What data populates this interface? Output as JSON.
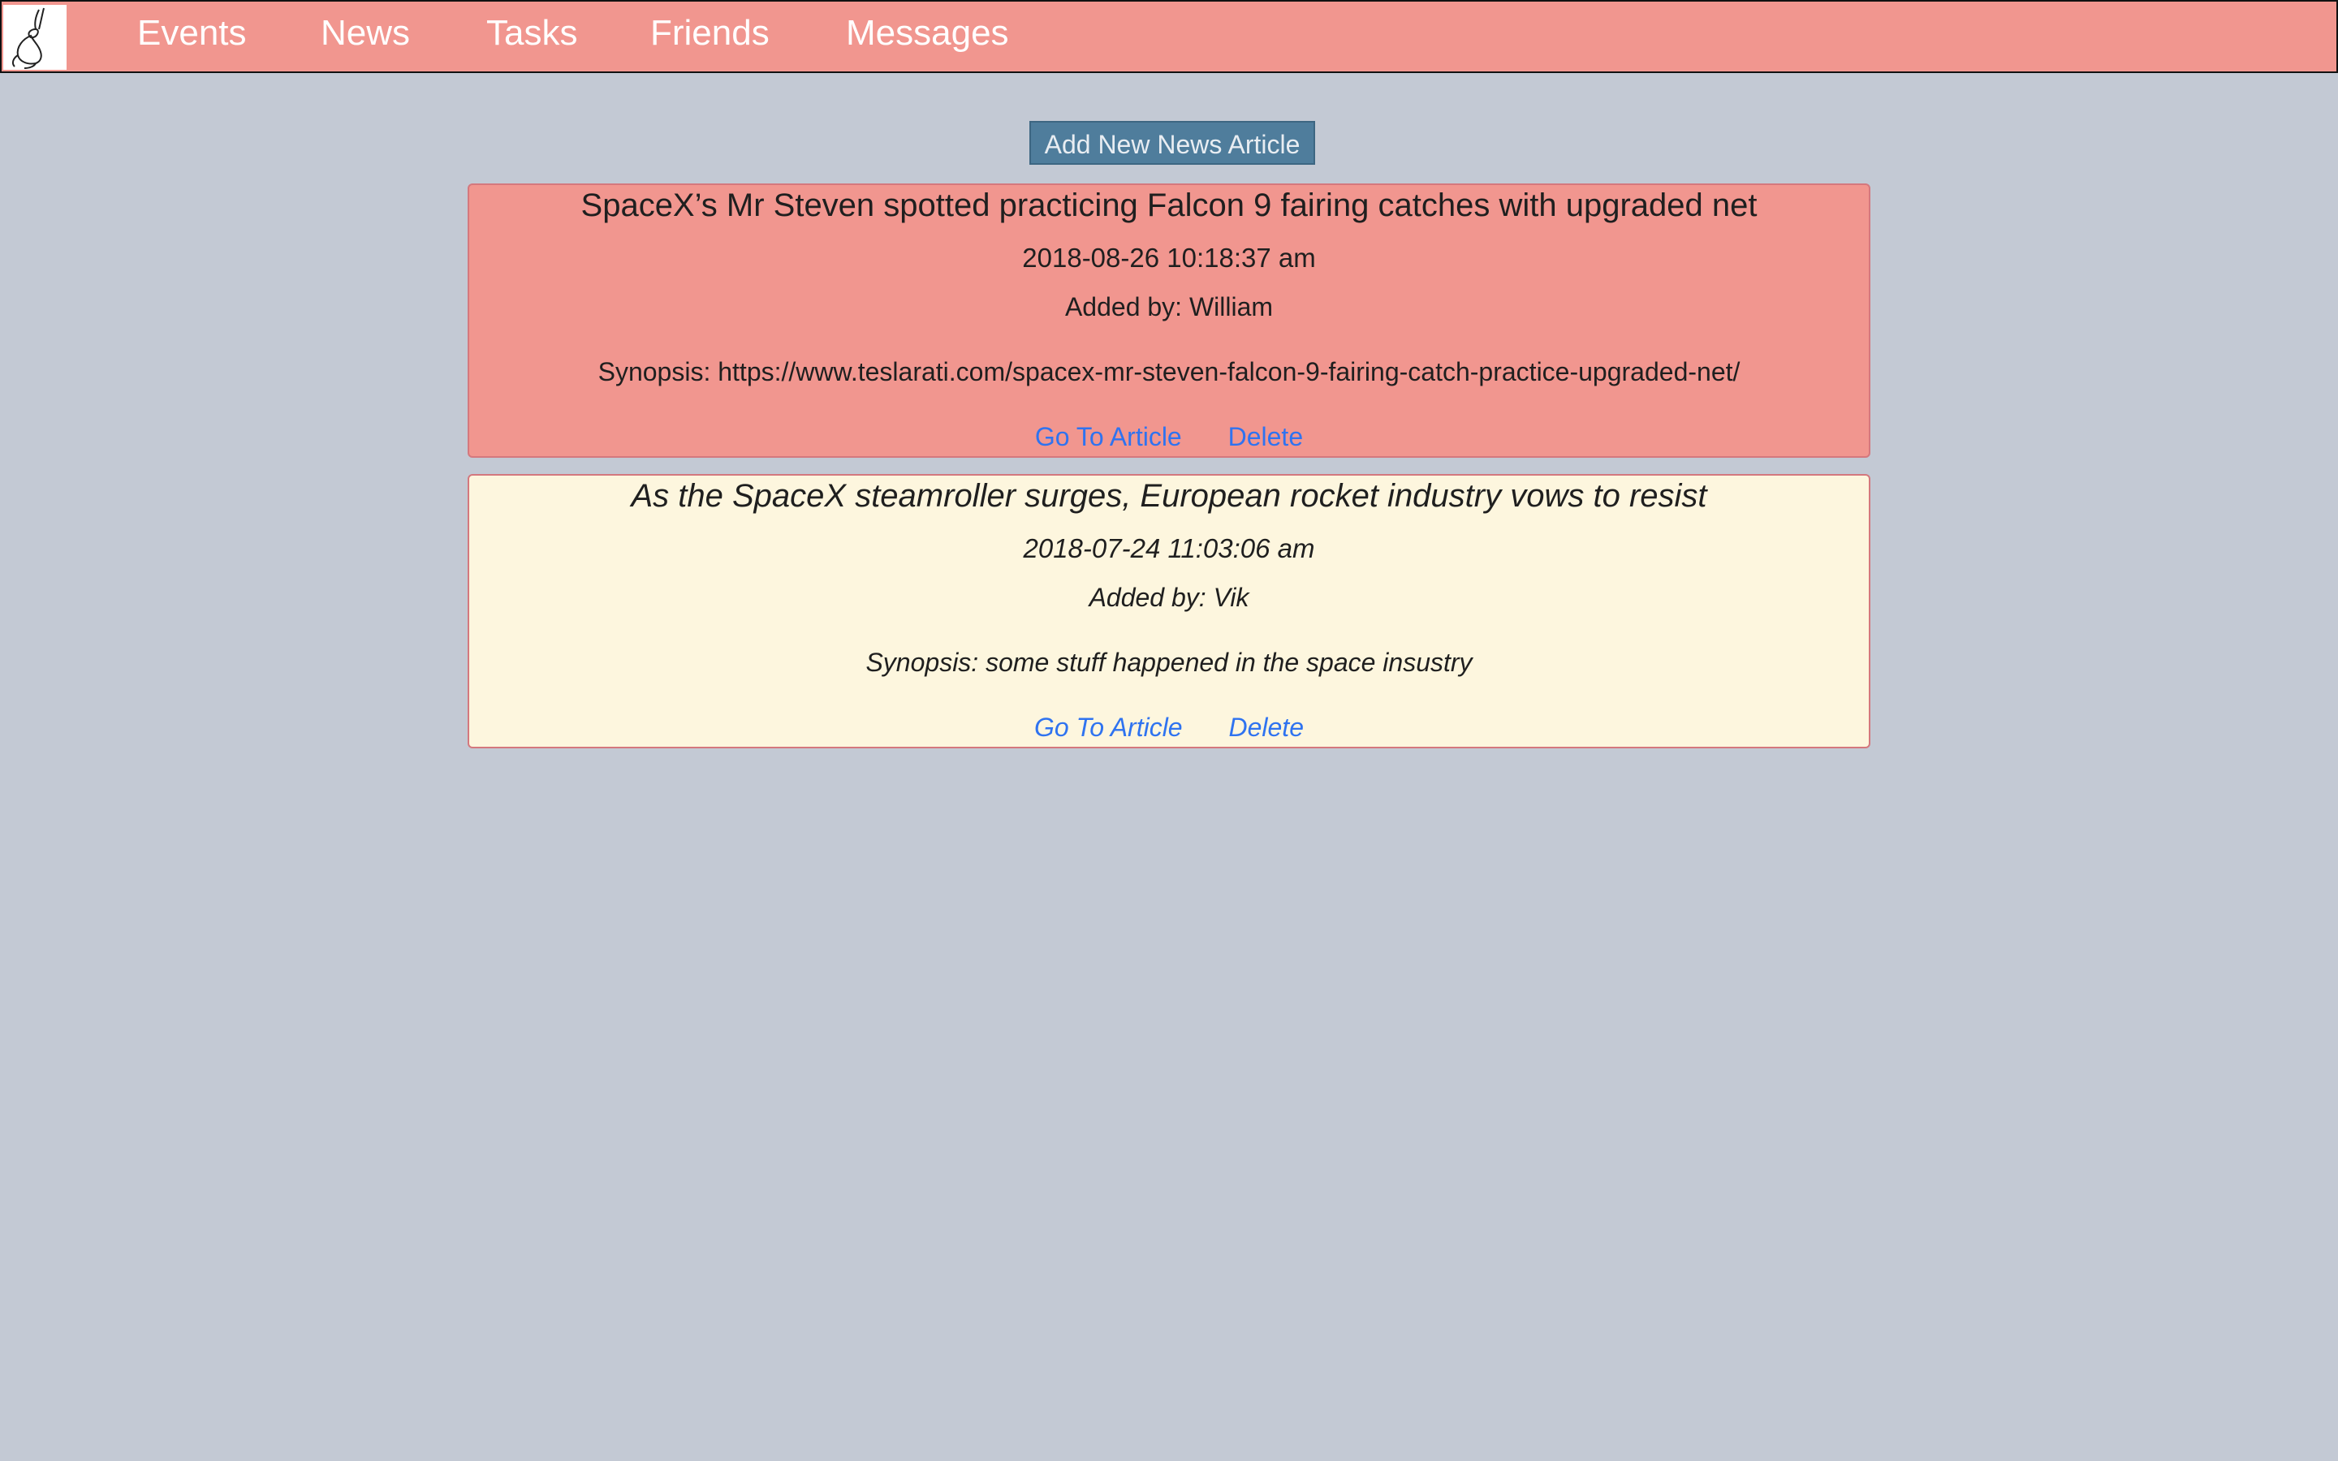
{
  "navbar": {
    "logo_icon": "rabbit-logo-icon",
    "items": [
      {
        "label": "Events"
      },
      {
        "label": "News"
      },
      {
        "label": "Tasks"
      },
      {
        "label": "Friends"
      },
      {
        "label": "Messages"
      }
    ]
  },
  "main": {
    "add_button_label": "Add New News Article",
    "articles": [
      {
        "title": "SpaceX’s Mr Steven spotted practicing Falcon 9 fairing catches with upgraded net",
        "date": "2018-08-26 10:18:37 am",
        "added_by": "Added by: William",
        "synopsis": "Synopsis: https://www.teslarati.com/spacex-mr-steven-falcon-9-fairing-catch-practice-upgraded-net/",
        "go_label": "Go To Article",
        "delete_label": "Delete",
        "bg_color": "#f1968f"
      },
      {
        "title": "As the SpaceX steamroller surges, European rocket industry vows to resist",
        "date": "2018-07-24 11:03:06 am",
        "added_by": "Added by: Vik",
        "synopsis": "Synopsis: some stuff happened in the space insustry",
        "go_label": "Go To Article",
        "delete_label": "Delete",
        "bg_color": "#fdf6de"
      }
    ]
  },
  "colors": {
    "page_bg": "#c3c9d4",
    "navbar_bg": "#f1968f",
    "button_bg": "#4f7d9c",
    "link": "#2f73f0"
  }
}
